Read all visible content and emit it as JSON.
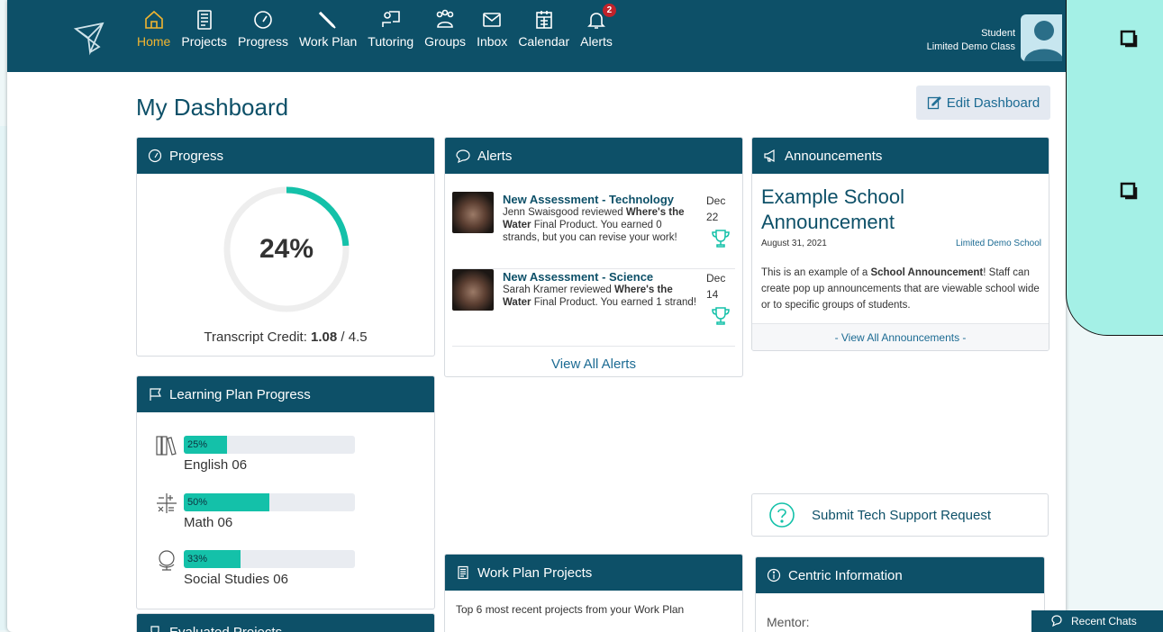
{
  "nav": {
    "items": [
      {
        "label": "Home",
        "icon": "home-icon"
      },
      {
        "label": "Projects",
        "icon": "projects-icon"
      },
      {
        "label": "Progress",
        "icon": "gauge-icon"
      },
      {
        "label": "Work Plan",
        "icon": "pencil-icon"
      },
      {
        "label": "Tutoring",
        "icon": "tutoring-icon"
      },
      {
        "label": "Groups",
        "icon": "groups-icon"
      },
      {
        "label": "Inbox",
        "icon": "envelope-icon"
      },
      {
        "label": "Calendar",
        "icon": "calendar-icon"
      },
      {
        "label": "Alerts",
        "icon": "bell-icon"
      }
    ],
    "alerts_badge": "2",
    "active_color": "#f2b530"
  },
  "user": {
    "name": "Student",
    "class_name": "Limited Demo Class"
  },
  "page": {
    "title": "My Dashboard",
    "edit_label": "Edit Dashboard"
  },
  "progress": {
    "title": "Progress",
    "percent_label": "24%",
    "percent": 24,
    "credit_label": "Transcript Credit: ",
    "credit_earned": "1.08",
    "credit_total": " / 4.5"
  },
  "alerts": {
    "title": "Alerts",
    "items": [
      {
        "title": "New Assessment - Technology",
        "reviewer": "Jenn Swaisgood reviewed ",
        "project_a": "Where's the",
        "project_b": "Water",
        "rest": " Final Product. You earned 0 strands, but you can revise your work!",
        "month": "Dec",
        "day": "22"
      },
      {
        "title": "New Assessment - Science",
        "reviewer": "Sarah Kramer reviewed ",
        "project_a": "Where's the",
        "project_b": "Water",
        "rest": " Final Product. You earned 1 strand!",
        "month": "Dec",
        "day": "14"
      }
    ],
    "view_all": "View All Alerts"
  },
  "announcements": {
    "title": "Announcements",
    "heading": "Example School Announcement",
    "date": "August 31, 2021",
    "school": "Limited Demo School",
    "body_pre": "This is an example of a ",
    "body_bold": "School Announcement",
    "body_post": "! Staff can create pop up announcements that are viewable school wide or to specific groups of students.",
    "view_all": "- View All Announcements -"
  },
  "learning_plan": {
    "title": "Learning Plan Progress",
    "subjects": [
      {
        "name": "English 06",
        "percent_label": "25%",
        "percent": 25,
        "icon": "books-icon"
      },
      {
        "name": "Math 06",
        "percent_label": "50%",
        "percent": 50,
        "icon": "math-icon"
      },
      {
        "name": "Social Studies 06",
        "percent_label": "33%",
        "percent": 33,
        "icon": "globe-icon"
      }
    ],
    "bar_color": "#14c1a9"
  },
  "tech_support": {
    "label": "Submit Tech Support Request"
  },
  "work_plan": {
    "title": "Work Plan Projects",
    "subtitle": "Top 6 most recent projects from your Work Plan"
  },
  "centric": {
    "title": "Centric Information",
    "mentor_label": "Mentor:"
  },
  "evaluated": {
    "title": "Evaluated Projects"
  },
  "chat": {
    "label": "Recent Chats"
  },
  "colors": {
    "header": "#0d5068",
    "accent": "#14c1a9",
    "callout": "#a4f0e6"
  }
}
